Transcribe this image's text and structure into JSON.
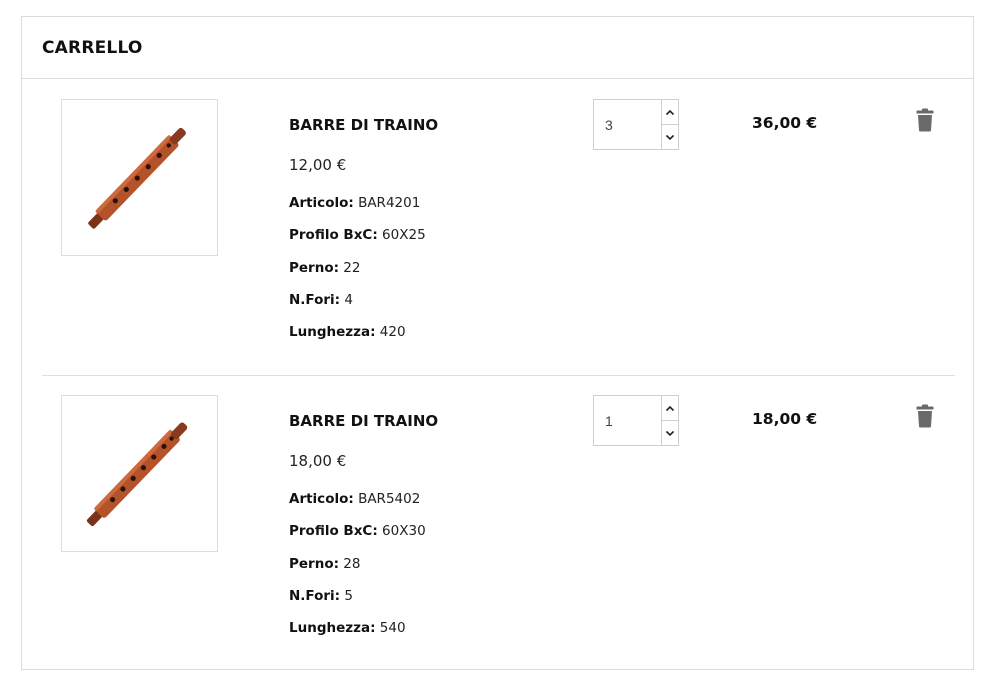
{
  "cart": {
    "title": "CARRELLO",
    "items": [
      {
        "name": "BARRE DI TRAINO",
        "unit_price": "12,00 €",
        "attributes": [
          {
            "label": "Articolo:",
            "value": "BAR4201"
          },
          {
            "label": "Profilo BxC:",
            "value": "60X25"
          },
          {
            "label": "Perno:",
            "value": "22"
          },
          {
            "label": "N.Fori:",
            "value": "4"
          },
          {
            "label": "Lunghezza:",
            "value": "420"
          }
        ],
        "quantity": "3",
        "line_total": "36,00 €",
        "image_icon": "tow-bar-product-image",
        "delete_icon": "trash-icon"
      },
      {
        "name": "BARRE DI TRAINO",
        "unit_price": "18,00 €",
        "attributes": [
          {
            "label": "Articolo:",
            "value": "BAR5402"
          },
          {
            "label": "Profilo BxC:",
            "value": "60X30"
          },
          {
            "label": "Perno:",
            "value": "28"
          },
          {
            "label": "N.Fori:",
            "value": "5"
          },
          {
            "label": "Lunghezza:",
            "value": "540"
          }
        ],
        "quantity": "1",
        "line_total": "18,00 €",
        "image_icon": "tow-bar-product-image",
        "delete_icon": "trash-icon"
      }
    ]
  },
  "colors": {
    "bar_main": "#b4522a",
    "bar_dark": "#7a3318",
    "trash": "#6a6a6a",
    "border": "#dcdcdc"
  }
}
